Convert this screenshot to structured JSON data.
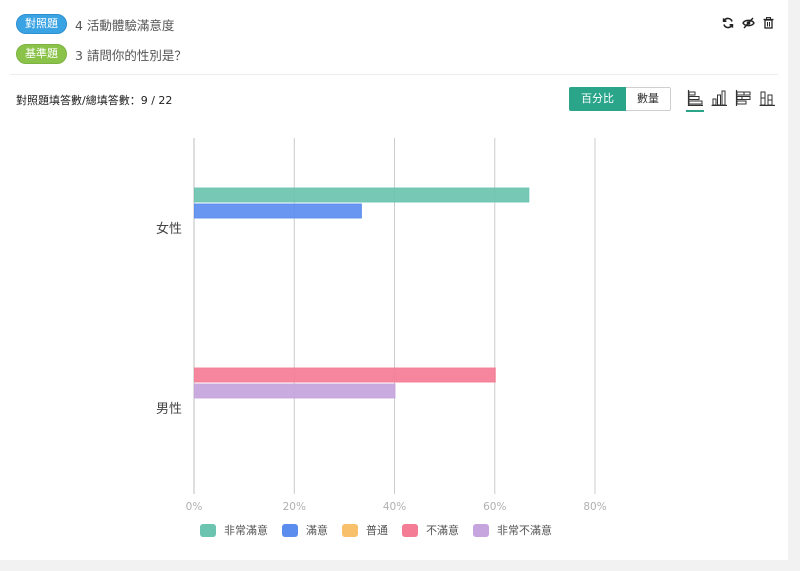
{
  "header": {
    "control_badge": "對照題",
    "control_question": "4 活動體驗滿意度",
    "base_badge": "基準題",
    "base_question": "3 請問你的性別是？",
    "icons": [
      "refresh-icon",
      "hide-eye-icon",
      "trash-icon"
    ]
  },
  "toolbar": {
    "count_label": "對照題填答數/總填答數：9 / 22",
    "mode_percent": "百分比",
    "mode_count": "數量",
    "chart_types": [
      "horizontal-bar-icon",
      "vertical-bar-icon",
      "stacked-horizontal-icon",
      "stacked-vertical-icon"
    ],
    "active_mode": "百分比",
    "active_chart_type": "horizontal-bar-icon"
  },
  "colors": {
    "accent": "#2aa58a",
    "series": [
      "#6cc3b0",
      "#5b8def",
      "#f9c06b",
      "#f47c95",
      "#c6a4dd"
    ]
  },
  "chart_data": {
    "type": "bar",
    "orientation": "horizontal",
    "categories": [
      "女性",
      "男性"
    ],
    "series": [
      {
        "name": "非常滿意",
        "values": [
          66.7,
          0
        ]
      },
      {
        "name": "滿意",
        "values": [
          33.3,
          0
        ]
      },
      {
        "name": "普通",
        "values": [
          0,
          0
        ]
      },
      {
        "name": "不滿意",
        "values": [
          0,
          60
        ]
      },
      {
        "name": "非常不滿意",
        "values": [
          0,
          40
        ]
      }
    ],
    "x_ticks": [
      "0%",
      "20%",
      "40%",
      "60%",
      "80%"
    ],
    "xlim": [
      0,
      80
    ],
    "grid": true,
    "legend_position": "bottom"
  }
}
